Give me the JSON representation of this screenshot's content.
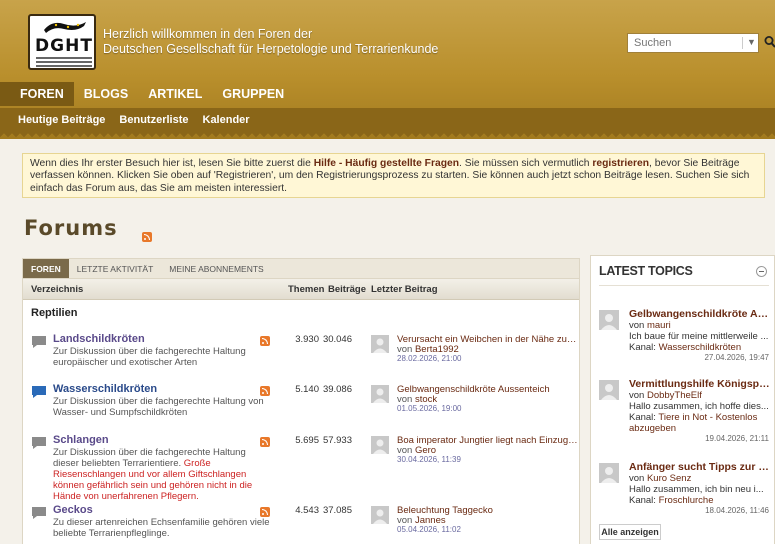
{
  "header": {
    "logo_text": "DGHT",
    "welcome_line1": "Herzlich willkommen in den Foren der",
    "welcome_line2": "Deutschen Gesellschaft für Herpetologie und Terrarienkunde",
    "search_placeholder": "Suchen"
  },
  "nav": {
    "main": [
      "FOREN",
      "BLOGS",
      "ARTIKEL",
      "GRUPPEN"
    ],
    "sub": [
      "Heutige Beiträge",
      "Benutzerliste",
      "Kalender"
    ]
  },
  "notice": {
    "part1": "Wenn dies Ihr erster Besuch hier ist, lesen Sie bitte zuerst die ",
    "link1": "Hilfe - Häufig gestellte Fragen",
    "part2": ". Sie müssen sich vermutlich ",
    "link2": "registrieren",
    "part3": ", bevor Sie Beiträge verfassen können. Klicken Sie oben auf 'Registrieren', um den Registrierungsprozess zu starten. Sie können auch jetzt schon Beiträge lesen. Suchen Sie sich einfach das Forum aus, das Sie am meisten interessiert."
  },
  "page_title": "Forums",
  "tabs": [
    "FOREN",
    "LETZTE AKTIVITÄT",
    "MEINE ABONNEMENTS"
  ],
  "table_headers": {
    "directory": "Verzeichnis",
    "threads": "Themen",
    "posts": "Beiträge",
    "last_post": "Letzter Beitrag"
  },
  "section": "Reptilien",
  "forums": [
    {
      "name": "Landschildkröten",
      "desc": "Zur Diskussion über die fachgerechte Haltung europäischer und exotischer Arten",
      "threads": "3.930",
      "posts": "30.046",
      "last_title": "Verursacht ein Weibchen in der Nähe zum Männch...",
      "last_by_prefix": "von ",
      "last_by": "Berta1992",
      "last_date": "28.02.2026, 21:00"
    },
    {
      "name": "Wasserschildkröten",
      "desc": "Zur Diskussion über die fachgerechte Haltung von Wasser- und Sumpfschildkröten",
      "threads": "5.140",
      "posts": "39.086",
      "last_title": "Gelbwangenschildkröte Aussenteich",
      "last_by_prefix": "von ",
      "last_by": "stock",
      "last_date": "01.05.2026, 19:00"
    },
    {
      "name": "Schlangen",
      "desc": "Zur Diskussion über die fachgerechte Haltung dieser beliebten Terrarientiere. ",
      "desc_red": "Große Riesenschlangen und vor allem Giftschlangen können gefährlich sein und gehören nicht in die Hände von unerfahrenen Pflegern.",
      "threads": "5.695",
      "posts": "57.933",
      "last_title": "Boa imperator Jungtier liegt nach Einzug nur im W...",
      "last_by_prefix": "von ",
      "last_by": "Gero",
      "last_date": "30.04.2026, 11:39"
    },
    {
      "name": "Geckos",
      "desc": "Zu dieser artenreichen Echsenfamilie gehören viele beliebte Terrarienpfleglinge.",
      "threads": "4.543",
      "posts": "37.085",
      "last_title": "Beleuchtung Taggecko",
      "last_by_prefix": "von ",
      "last_by": "Jannes",
      "last_date": "05.04.2026, 11:02"
    }
  ],
  "latest_topics": {
    "title": "LATEST TOPICS",
    "show_all": "Alle anzeigen",
    "items": [
      {
        "title": "Gelbwangenschildkröte Aus...",
        "by_prefix": "von ",
        "by": "mauri",
        "excerpt": "Ich baue für meine mittlerweile ...",
        "channel_prefix": "Kanal: ",
        "channel": "Wasserschildkröten",
        "date": "27.04.2026, 19:47"
      },
      {
        "title": "Vermittlungshilfe Königspyth...",
        "by_prefix": "von ",
        "by": "DobbyTheElf",
        "excerpt": "Hallo zusammen, ich hoffe dies...",
        "channel_prefix": "Kanal: ",
        "channel": "Tiere in Not - Kostenlos",
        "channel_cont": "abzugeben",
        "date": "19.04.2026, 21:11"
      },
      {
        "title": "Anfänger sucht Tipps zur Fro...",
        "by_prefix": "von ",
        "by": "Kuro Senz",
        "excerpt": "Hallo zusammen, ich bin neu i...",
        "channel_prefix": "Kanal: ",
        "channel": "Froschlurche",
        "date": "18.04.2026, 11:46"
      }
    ]
  },
  "colors": {
    "header_gold": "#b98f2c",
    "nav_brown": "#8a6618",
    "link_brown": "#6a2a12",
    "notice_bg": "#fff7d6",
    "rss_orange": "#e8782a"
  }
}
